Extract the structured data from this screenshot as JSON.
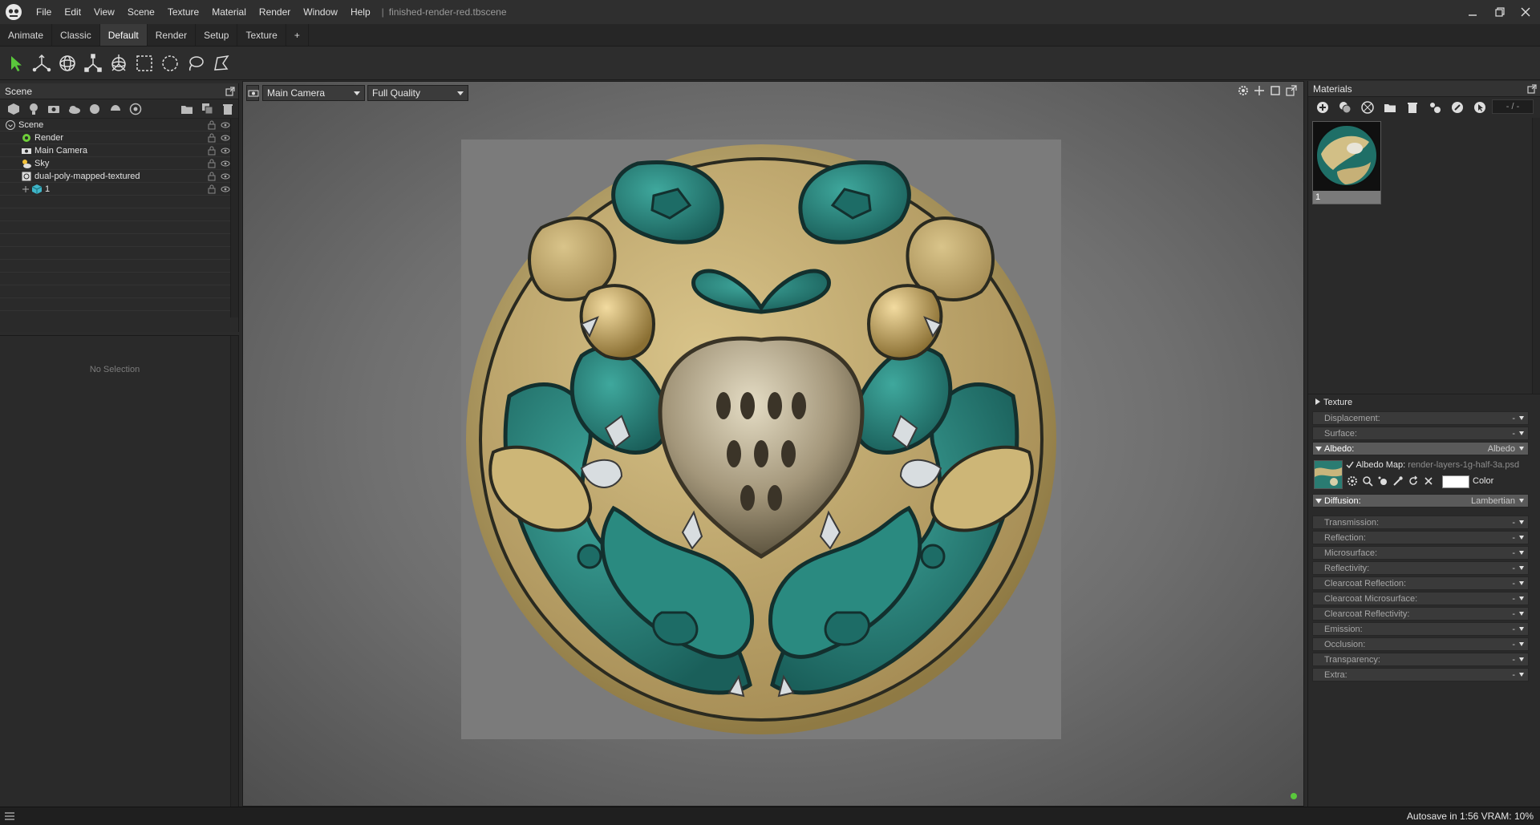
{
  "menu": [
    "File",
    "Edit",
    "View",
    "Scene",
    "Texture",
    "Material",
    "Render",
    "Window",
    "Help"
  ],
  "window_title": "finished-render-red.tbscene",
  "title_separator": "|",
  "workspace_tabs": [
    {
      "label": "Animate",
      "active": false
    },
    {
      "label": "Classic",
      "active": false
    },
    {
      "label": "Default",
      "active": true
    },
    {
      "label": "Render",
      "active": false
    },
    {
      "label": "Setup",
      "active": false
    },
    {
      "label": "Texture",
      "active": false
    },
    {
      "label": "+",
      "active": false
    }
  ],
  "toolbar_icons": [
    "select-arrow-icon",
    "move-icon",
    "rotate-icon",
    "scale-icon",
    "transform-gizmo-icon",
    "rect-select-icon",
    "circle-select-icon",
    "lasso-select-icon",
    "polygon-select-icon"
  ],
  "accent_color": "#5ac83c",
  "scene": {
    "title": "Scene",
    "tree": [
      {
        "label": "Scene",
        "depth": 0,
        "icon": "scene-icon"
      },
      {
        "label": "Render",
        "depth": 1,
        "icon": "render-gear-icon"
      },
      {
        "label": "Main Camera",
        "depth": 1,
        "icon": "camera-icon"
      },
      {
        "label": "Sky",
        "depth": 1,
        "icon": "sky-icon"
      },
      {
        "label": "dual-poly-mapped-textured",
        "depth": 1,
        "icon": "mesh-object-icon"
      },
      {
        "label": "1",
        "depth": 2,
        "icon": "cube-icon"
      }
    ]
  },
  "properties": {
    "empty_text": "No Selection"
  },
  "viewport": {
    "camera_select": "Main Camera",
    "quality_select": "Full Quality"
  },
  "materials": {
    "title": "Materials",
    "count": "- / -",
    "thumb_label": "1",
    "texture_section": "Texture",
    "displacement": {
      "label": "Displacement:",
      "value": "-"
    },
    "surface": {
      "label": "Surface:",
      "value": "-"
    },
    "albedo": {
      "label": "Albedo:",
      "value": "Albedo"
    },
    "albedo_map_label": "Albedo Map:",
    "albedo_map_file": "render-layers-1g-half-3a.psd",
    "albedo_color_label": "Color",
    "albedo_color": "#ffffff",
    "diffusion": {
      "label": "Diffusion:",
      "value": "Lambertian"
    },
    "rows": [
      {
        "label": "Transmission:",
        "value": "-"
      },
      {
        "label": "Reflection:",
        "value": "-"
      },
      {
        "label": "Microsurface:",
        "value": "-"
      },
      {
        "label": "Reflectivity:",
        "value": "-"
      },
      {
        "label": "Clearcoat Reflection:",
        "value": "-"
      },
      {
        "label": "Clearcoat Microsurface:",
        "value": "-"
      },
      {
        "label": "Clearcoat Reflectivity:",
        "value": "-"
      },
      {
        "label": "Emission:",
        "value": "-"
      },
      {
        "label": "Occlusion:",
        "value": "-"
      },
      {
        "label": "Transparency:",
        "value": "-"
      },
      {
        "label": "Extra:",
        "value": "-"
      }
    ]
  },
  "status": {
    "text": "Autosave in 1:56  VRAM: 10%"
  }
}
